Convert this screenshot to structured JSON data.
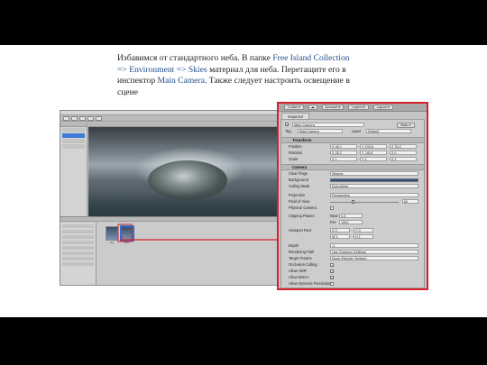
{
  "caption": {
    "part1": "Избавимся от стандартного неба. В папке ",
    "link1": "Free Island Collection => Environment => Skies",
    "part2": " материал для неба. Перетащите его в инспектор ",
    "link2": "Main Camera",
    "part3": ". Также следует настроить освещение в сцене"
  },
  "editor": {
    "project_assets": [
      {
        "label": "sky",
        "selected": false
      },
      {
        "label": "sky 2",
        "selected": true
      }
    ]
  },
  "inspector": {
    "toolbar": {
      "collab": "Collab ▾",
      "cloud_icon": "cloud-icon",
      "account": "Account ▾",
      "layers": "Layers ▾",
      "layout": "Layout ▾"
    },
    "tab": "Inspector",
    "object_name": "Main Camera",
    "static_label": "Static ▾",
    "tag_label": "Tag",
    "tag_value": "MainCamera",
    "layer_label": "Layer",
    "layer_value": "Default",
    "transform": {
      "header": "Transform",
      "position_label": "Position",
      "position": {
        "x": "X 45.1",
        "y": "Y 103.5",
        "z": "Z 76.2"
      },
      "rotation_label": "Rotation",
      "rotation": {
        "x": "X 26.2",
        "y": "Y -45.8",
        "z": "Z 0"
      },
      "scale_label": "Scale",
      "scale": {
        "x": "X 1",
        "y": "Y 1",
        "z": "Z 1"
      }
    },
    "camera": {
      "header": "Camera",
      "clear_flags_label": "Clear Flags",
      "clear_flags_value": "Skybox",
      "background_label": "Background",
      "background_color": "#2e4f7a",
      "culling_mask_label": "Culling Mask",
      "culling_mask_value": "Everything",
      "projection_label": "Projection",
      "projection_value": "Perspective",
      "fov_label": "Field of View",
      "fov_value": "60",
      "fov_fraction": 0.33,
      "physical_label": "Physical Camera",
      "clipping_label": "Clipping Planes",
      "near_label": "Near",
      "near_value": "0.3",
      "far_label": "Far",
      "far_value": "1000",
      "viewport_label": "Viewport Rect",
      "viewport": {
        "x": "X 0",
        "y": "Y 0",
        "w": "W 1",
        "h": "H 1"
      },
      "depth_label": "Depth",
      "depth_value": "-1",
      "rendering_path_label": "Rendering Path",
      "rendering_path_value": "Use Graphics Settings",
      "target_texture_label": "Target Texture",
      "target_texture_value": "None (Render Texture)",
      "occlusion_label": "Occlusion Culling",
      "hdr_label": "Allow HDR",
      "msaa_label": "Allow MSAA",
      "dynres_label": "Allow Dynamic Resolution"
    }
  },
  "colors": {
    "highlight_text": "#1f4e8c",
    "callout_red": "#d8222b",
    "selection_blue": "#3e7bd6"
  }
}
